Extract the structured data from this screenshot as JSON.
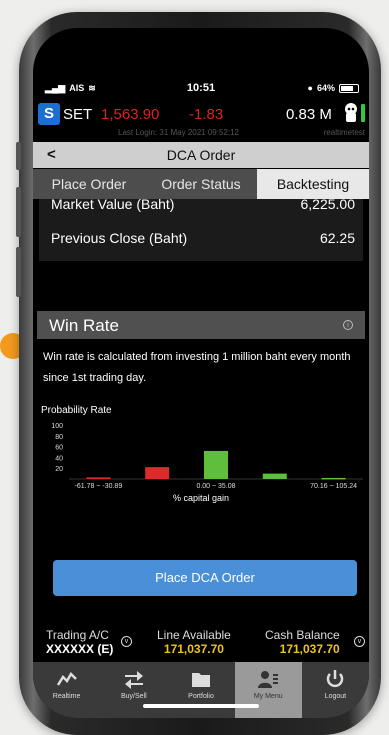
{
  "status": {
    "carrier": "AIS",
    "time": "10:51",
    "battery": "64%"
  },
  "ticker": {
    "symbol": "SET",
    "index": "1,563.90",
    "change": "-1.83",
    "volume": "0.83 M",
    "last_login": "Last Login: 31 May 2021 09:52:12",
    "user": "realtimetest"
  },
  "page": {
    "title": "DCA Order",
    "back": "<"
  },
  "tabs": [
    {
      "label": "Place Order"
    },
    {
      "label": "Order Status"
    },
    {
      "label": "Backtesting",
      "active": true
    }
  ],
  "summary": {
    "market_value_label": "Market Value (Baht)",
    "market_value": "6,225.00",
    "prev_close_label": "Previous Close (Baht)",
    "prev_close": "62.25"
  },
  "win_rate": {
    "heading": "Win Rate",
    "description": "Win rate is calculated from investing 1 million baht every month since 1st trading day.",
    "prob_label": "Probability Rate"
  },
  "chart_data": {
    "type": "bar",
    "ylabel": "Probability Rate",
    "xlabel": "% capital gain",
    "ylim": [
      0,
      100
    ],
    "yticks": [
      "100",
      "80",
      "60",
      "40",
      "20"
    ],
    "xticks": [
      "-61.78 ~ -30.89",
      "0.00 ~ 35.08",
      "70.16 ~ 105.24"
    ],
    "bars": [
      {
        "value": 3,
        "color": "#e02a2a"
      },
      {
        "value": 22,
        "color": "#e02a2a"
      },
      {
        "value": 52,
        "color": "#5fbf3a"
      },
      {
        "value": 10,
        "color": "#5fbf3a"
      },
      {
        "value": 2,
        "color": "#5fbf3a"
      }
    ]
  },
  "actions": {
    "place_dca": "Place DCA Order"
  },
  "account": {
    "trading_label": "Trading A/C",
    "trading_value": "XXXXXX (E)",
    "line_label": "Line Available",
    "line_value": "171,037.70",
    "cash_label": "Cash Balance",
    "cash_value": "171,037.70"
  },
  "nav": [
    {
      "label": "Realtime",
      "icon": "chart-line-icon"
    },
    {
      "label": "Buy/Sell",
      "icon": "arrows-icon"
    },
    {
      "label": "Portfolio",
      "icon": "folder-icon"
    },
    {
      "label": "My Menu",
      "icon": "user-card-icon",
      "active": true
    },
    {
      "label": "Logout",
      "icon": "power-icon"
    }
  ],
  "colors": {
    "accent": "#4a90d9",
    "down": "#e02020",
    "value": "#f0c419"
  }
}
